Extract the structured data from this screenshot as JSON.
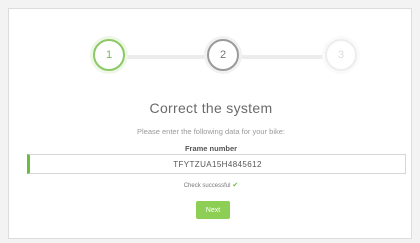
{
  "wizard": {
    "steps": [
      {
        "label": "1",
        "state": "completed"
      },
      {
        "label": "2",
        "state": "active"
      },
      {
        "label": "3",
        "state": "upcoming"
      }
    ]
  },
  "form": {
    "title": "Correct the system",
    "instruction": "Please enter the following data for your bike:",
    "field_label": "Frame number",
    "field_value": "TFYTZUA15H4845612",
    "check_text": "Check successful",
    "next_label": "Next"
  },
  "colors": {
    "accent_green": "#8ccf54",
    "success_green": "#6bbd3d",
    "active_step_gray": "#9a9a9a"
  }
}
